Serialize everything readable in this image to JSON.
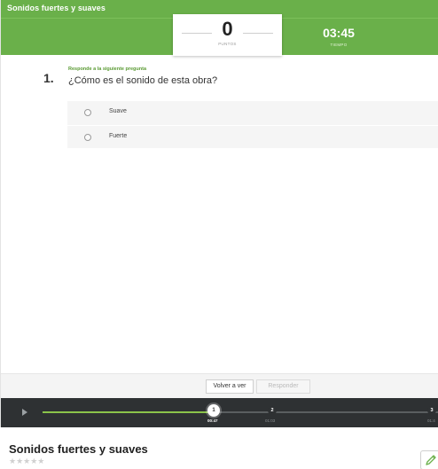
{
  "activity": {
    "title": "Sonidos fuertes y suaves"
  },
  "score": {
    "points_value": "0",
    "points_label": "PUNTOS",
    "time_value": "03:45",
    "time_label": "TIEMPO"
  },
  "question": {
    "number": "1.",
    "instruction": "Responde a la siguiente pregunta",
    "text": "¿Cómo es el sonido de esta obra?",
    "options": [
      "Suave",
      "Fuerte"
    ]
  },
  "buttons": {
    "back_label": "Volver a ver",
    "answer_label": "Responder"
  },
  "player": {
    "progress": 0.43,
    "markers": [
      {
        "label": "1",
        "time": "00:47"
      },
      {
        "label": "2",
        "time": "01:03"
      },
      {
        "label": "3",
        "time": "01:4"
      }
    ]
  },
  "page": {
    "title": "Sonidos fuertes y suaves",
    "stars": "★★★★★",
    "rating": 0
  },
  "colors": {
    "accent": "#6ab04a",
    "player_bg": "#2e3133",
    "progress": "#8bc34a"
  },
  "icons": {
    "play": "play-icon",
    "edit": "pencil-icon"
  }
}
